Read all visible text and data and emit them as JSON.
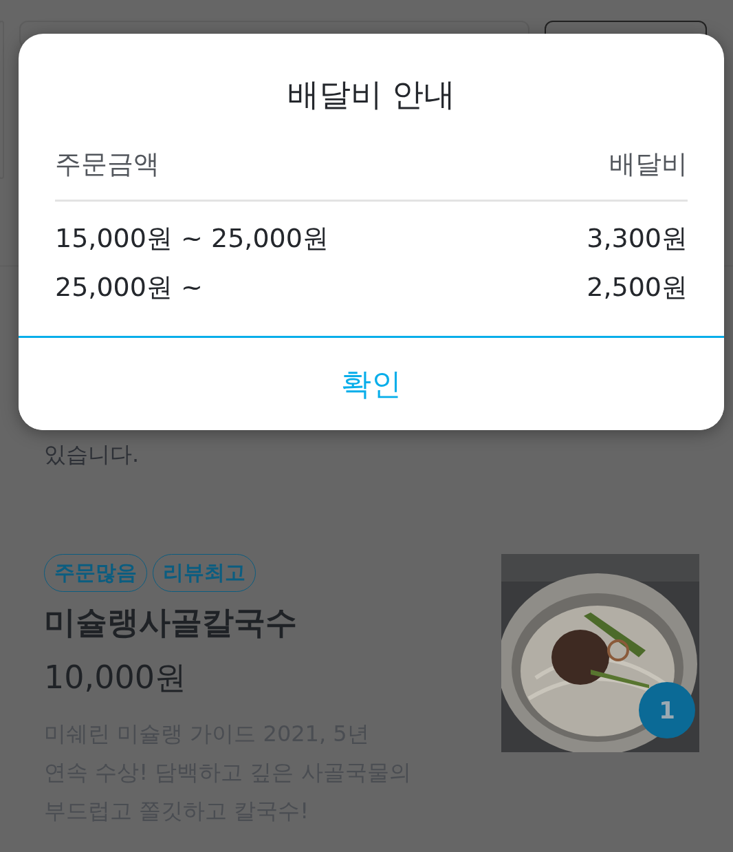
{
  "menu_item": {
    "intro_tail": "있습니다.",
    "tags": [
      {
        "label": "주문많음"
      },
      {
        "label": "리뷰최고"
      }
    ],
    "name": "미슐랭사골칼국수",
    "price": "10,000원",
    "description": "미쉐린 미슐랭 가이드 2021, 5년\n연속 수상! 담백하고 깊은 사골국물의\n부드럽고 쫄깃하고 칼국수!",
    "photo": {
      "kind": "picture",
      "badge": "1"
    }
  },
  "dialog": {
    "title": "배달비 안내",
    "columns": [
      "주문금액",
      "배달비"
    ],
    "rows": [
      {
        "range": "15,000원 ~ 25,000원",
        "fee": "3,300원"
      },
      {
        "range": "25,000원 ~",
        "fee": "2,500원"
      }
    ],
    "confirm": "확인"
  }
}
